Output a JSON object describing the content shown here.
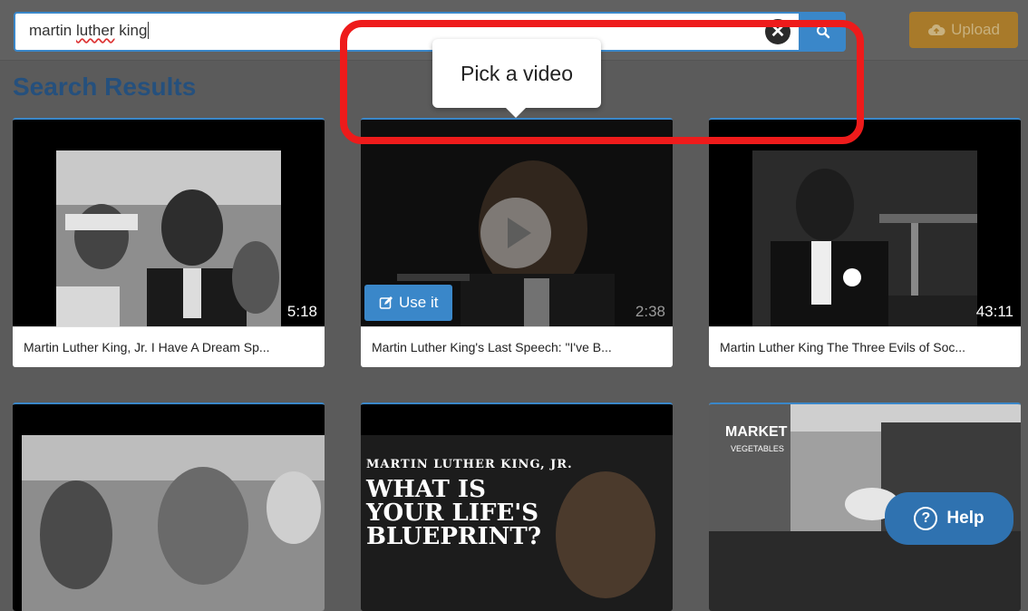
{
  "search": {
    "value": "martin luther king",
    "value_before": "martin ",
    "value_misspelled": "luther",
    "value_after": " king",
    "clear_glyph": "✕",
    "search_icon": "search-icon"
  },
  "toolbar": {
    "upload_label": "Upload",
    "upload_icon": "cloud-upload-icon"
  },
  "results": {
    "heading": "Search Results",
    "videos": [
      {
        "title": "Martin Luther King, Jr. I Have A Dream Sp...",
        "duration": "5:18"
      },
      {
        "title": "Martin Luther King's Last Speech: \"I've B...",
        "duration": "2:38"
      },
      {
        "title": "Martin Luther King The Three Evils of Soc...",
        "duration": "43:11"
      },
      {
        "title": "",
        "duration": ""
      },
      {
        "title": "",
        "duration": "",
        "overlay_line1": "MARTIN LUTHER KING, JR.",
        "overlay_line2": "WHAT IS",
        "overlay_line3": "YOUR LIFE'S",
        "overlay_line4": "BLUEPRINT?"
      },
      {
        "title": "",
        "duration": "",
        "sign_text": "MARKET",
        "sign_sub": "VEGETABLES"
      }
    ],
    "use_it_label": "Use it"
  },
  "tooltip": {
    "text": "Pick a video"
  },
  "help": {
    "label": "Help",
    "glyph": "?"
  },
  "colors": {
    "accent": "#3a87c9",
    "upload": "#a87a2a",
    "highlight": "#ee1b1b",
    "heading": "#25507d"
  }
}
